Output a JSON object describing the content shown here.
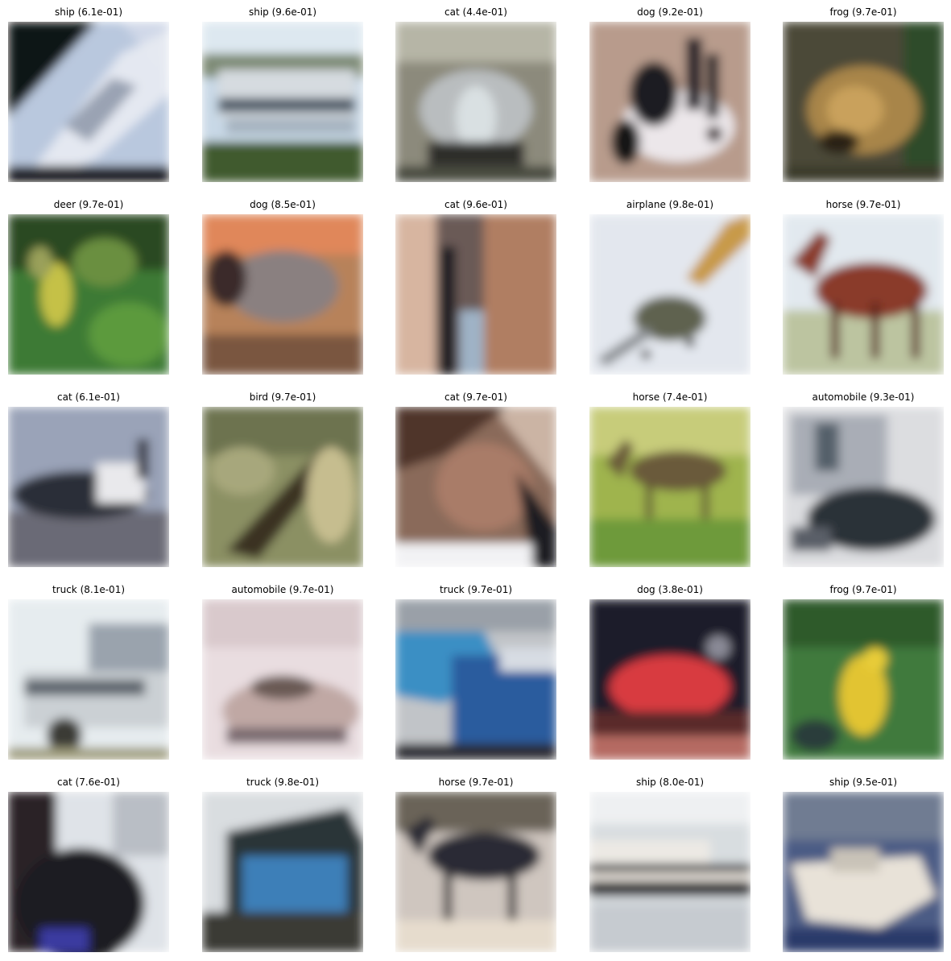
{
  "grid": [
    {
      "label": "ship (6.1e-01)",
      "scene": "ship-diagonal"
    },
    {
      "label": "ship (9.6e-01)",
      "scene": "ship-river"
    },
    {
      "label": "cat (4.4e-01)",
      "scene": "car-front-grey"
    },
    {
      "label": "dog (9.2e-01)",
      "scene": "dog-black-white"
    },
    {
      "label": "frog (9.7e-01)",
      "scene": "frog-brown"
    },
    {
      "label": "deer (9.7e-01)",
      "scene": "deer-green"
    },
    {
      "label": "dog (8.5e-01)",
      "scene": "dog-grey-orange"
    },
    {
      "label": "cat (9.6e-01)",
      "scene": "cat-closeup"
    },
    {
      "label": "airplane (9.8e-01)",
      "scene": "airplane-sky"
    },
    {
      "label": "horse (9.7e-01)",
      "scene": "horse-brown"
    },
    {
      "label": "cat (6.1e-01)",
      "scene": "car-grey-road"
    },
    {
      "label": "bird (9.7e-01)",
      "scene": "bird-olive"
    },
    {
      "label": "cat (9.7e-01)",
      "scene": "cat-face"
    },
    {
      "label": "horse (7.4e-01)",
      "scene": "horse-field"
    },
    {
      "label": "automobile (9.3e-01)",
      "scene": "car-dark-building"
    },
    {
      "label": "truck (8.1e-01)",
      "scene": "truck-white"
    },
    {
      "label": "automobile (9.7e-01)",
      "scene": "car-pink"
    },
    {
      "label": "truck (9.7e-01)",
      "scene": "truck-blue"
    },
    {
      "label": "dog (3.8e-01)",
      "scene": "red-car-dark"
    },
    {
      "label": "frog (9.7e-01)",
      "scene": "frog-yellow"
    },
    {
      "label": "cat (7.6e-01)",
      "scene": "cat-dark-blue"
    },
    {
      "label": "truck (9.8e-01)",
      "scene": "truck-blue-box"
    },
    {
      "label": "horse (9.7e-01)",
      "scene": "horse-dark"
    },
    {
      "label": "ship (8.0e-01)",
      "scene": "ship-white-black"
    },
    {
      "label": "ship (9.5e-01)",
      "scene": "ship-blue-water"
    }
  ]
}
